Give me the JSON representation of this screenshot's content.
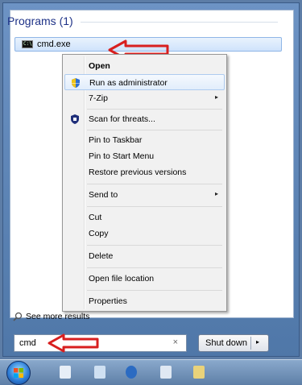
{
  "programs": {
    "heading": "Programs (1)",
    "item_label": "cmd.exe",
    "icon": "cmd-icon"
  },
  "context_menu": {
    "items": [
      {
        "label": "Open",
        "bold": true
      },
      {
        "label": "Run as administrator",
        "icon": "shield-icon"
      },
      {
        "label": "7-Zip",
        "submenu": true
      },
      {
        "label": "Scan for threats...",
        "icon": "antivirus-icon"
      },
      {
        "label": "Pin to Taskbar"
      },
      {
        "label": "Pin to Start Menu"
      },
      {
        "label": "Restore previous versions"
      },
      {
        "label": "Send to",
        "submenu": true
      },
      {
        "label": "Cut"
      },
      {
        "label": "Copy"
      },
      {
        "label": "Delete"
      },
      {
        "label": "Open file location"
      },
      {
        "label": "Properties"
      }
    ],
    "submenu_arrow": "▸"
  },
  "see_more": {
    "label": "See more results"
  },
  "search": {
    "value": "cmd",
    "clear_glyph": "×"
  },
  "shutdown": {
    "label": "Shut down",
    "arrow": "▸"
  },
  "colors": {
    "annotation_arrow": "#d81f1f",
    "heading": "#1e3287",
    "highlight": "#aecbef"
  }
}
